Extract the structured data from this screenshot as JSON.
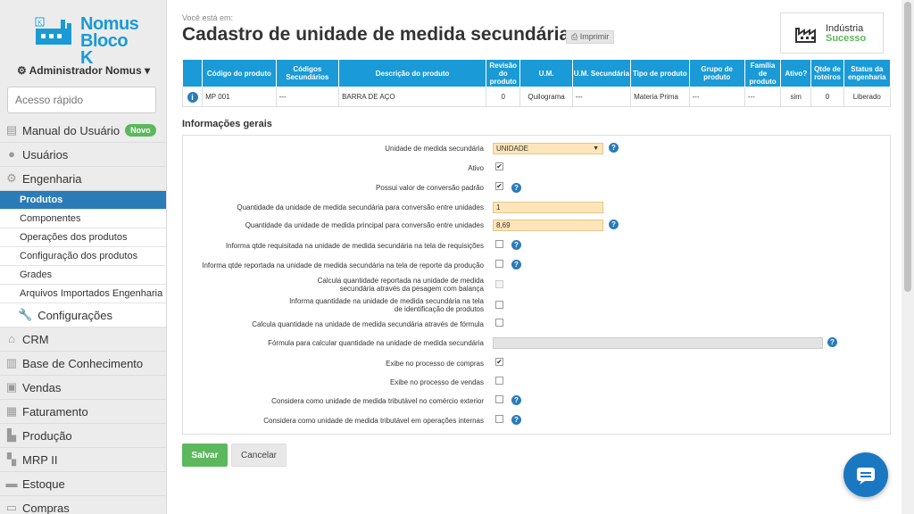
{
  "sidebar": {
    "logo_line1": "Nomus",
    "logo_line2": "Bloco K",
    "user": "Administrador Nomus",
    "quick_placeholder": "Acesso rápido",
    "items": {
      "manual": {
        "label": "Manual do Usuário",
        "badge": "Novo"
      },
      "usuarios": {
        "label": "Usuários"
      },
      "engenharia": {
        "label": "Engenharia"
      },
      "crm": {
        "label": "CRM"
      },
      "base": {
        "label": "Base de Conhecimento"
      },
      "vendas": {
        "label": "Vendas"
      },
      "faturamento": {
        "label": "Faturamento"
      },
      "producao": {
        "label": "Produção"
      },
      "mrp": {
        "label": "MRP II"
      },
      "estoque": {
        "label": "Estoque"
      },
      "compras": {
        "label": "Compras"
      }
    },
    "eng_sub": [
      "Produtos",
      "Componentes",
      "Operações dos produtos",
      "Configuração dos produtos",
      "Grades",
      "Arquivos Importados Engenharia"
    ],
    "config": "Configurações"
  },
  "header": {
    "breadcrumb": "Você está em:",
    "title": "Cadastro de unidade de medida secundária",
    "print": "Imprimir",
    "brand_line1": "Indústria",
    "brand_line2": "Sucesso"
  },
  "product_table": {
    "headers": [
      "",
      "Código do produto",
      "Códigos Secundários",
      "Descrição do produto",
      "Revisão do produto",
      "U.M.",
      "U.M. Secundária",
      "Tipo de produto",
      "Grupo de produto",
      "Família de produto",
      "Ativo?",
      "Qtde de roteiros",
      "Status da engenharia"
    ],
    "row": [
      "i",
      "MP 001",
      "---",
      "BARRA DE AÇO",
      "0",
      "Quilograma",
      "---",
      "Materia Prima",
      "---",
      "---",
      "sim",
      "0",
      "Liberado"
    ]
  },
  "form": {
    "section": "Informações gerais",
    "unidade_label": "Unidade de medida secundária",
    "unidade_value": "UNIDADE",
    "ativo_label": "Ativo",
    "ativo_checked": true,
    "conv_padrao_label": "Possui valor de conversão padrão",
    "conv_padrao_checked": true,
    "qtd_sec_label": "Quantidade da unidade de medida secundária para conversão entre unidades",
    "qtd_sec_value": "1",
    "qtd_pri_label": "Quantidade da unidade de medida principal para conversão entre unidades",
    "qtd_pri_value": "8,69",
    "req_label": "Informa qtde requisitada na unidade de medida secundária na tela de requisições",
    "rep_label": "Informa qtde reportada na unidade de medida secundária na tela de reporte da produção",
    "balanca_label": "Calcula quantidade reportada na unidade de medida secundária através da pesagem com balança",
    "ident_label": "Informa quantidade na unidade de medida secundária na tela de identificação de produtos",
    "formula_calc_label": "Calcula quantidade na unidade de medida secundária através de fórmula",
    "formula_label": "Fórmula para calcular quantidade na unidade de medida secundária",
    "compras_label": "Exibe no processo de compras",
    "compras_checked": true,
    "vendas_label": "Exibe no processo de vendas",
    "comex_label": "Considera como unidade de medida tributável no comércio exterior",
    "internas_label": "Considera como unidade de medida tributável em operações internas"
  },
  "buttons": {
    "save": "Salvar",
    "cancel": "Cancelar"
  },
  "colors": {
    "accent": "#1a9ad6",
    "active": "#2b7bb9",
    "success": "#5cb85c",
    "input_bg": "#fde5b9"
  }
}
